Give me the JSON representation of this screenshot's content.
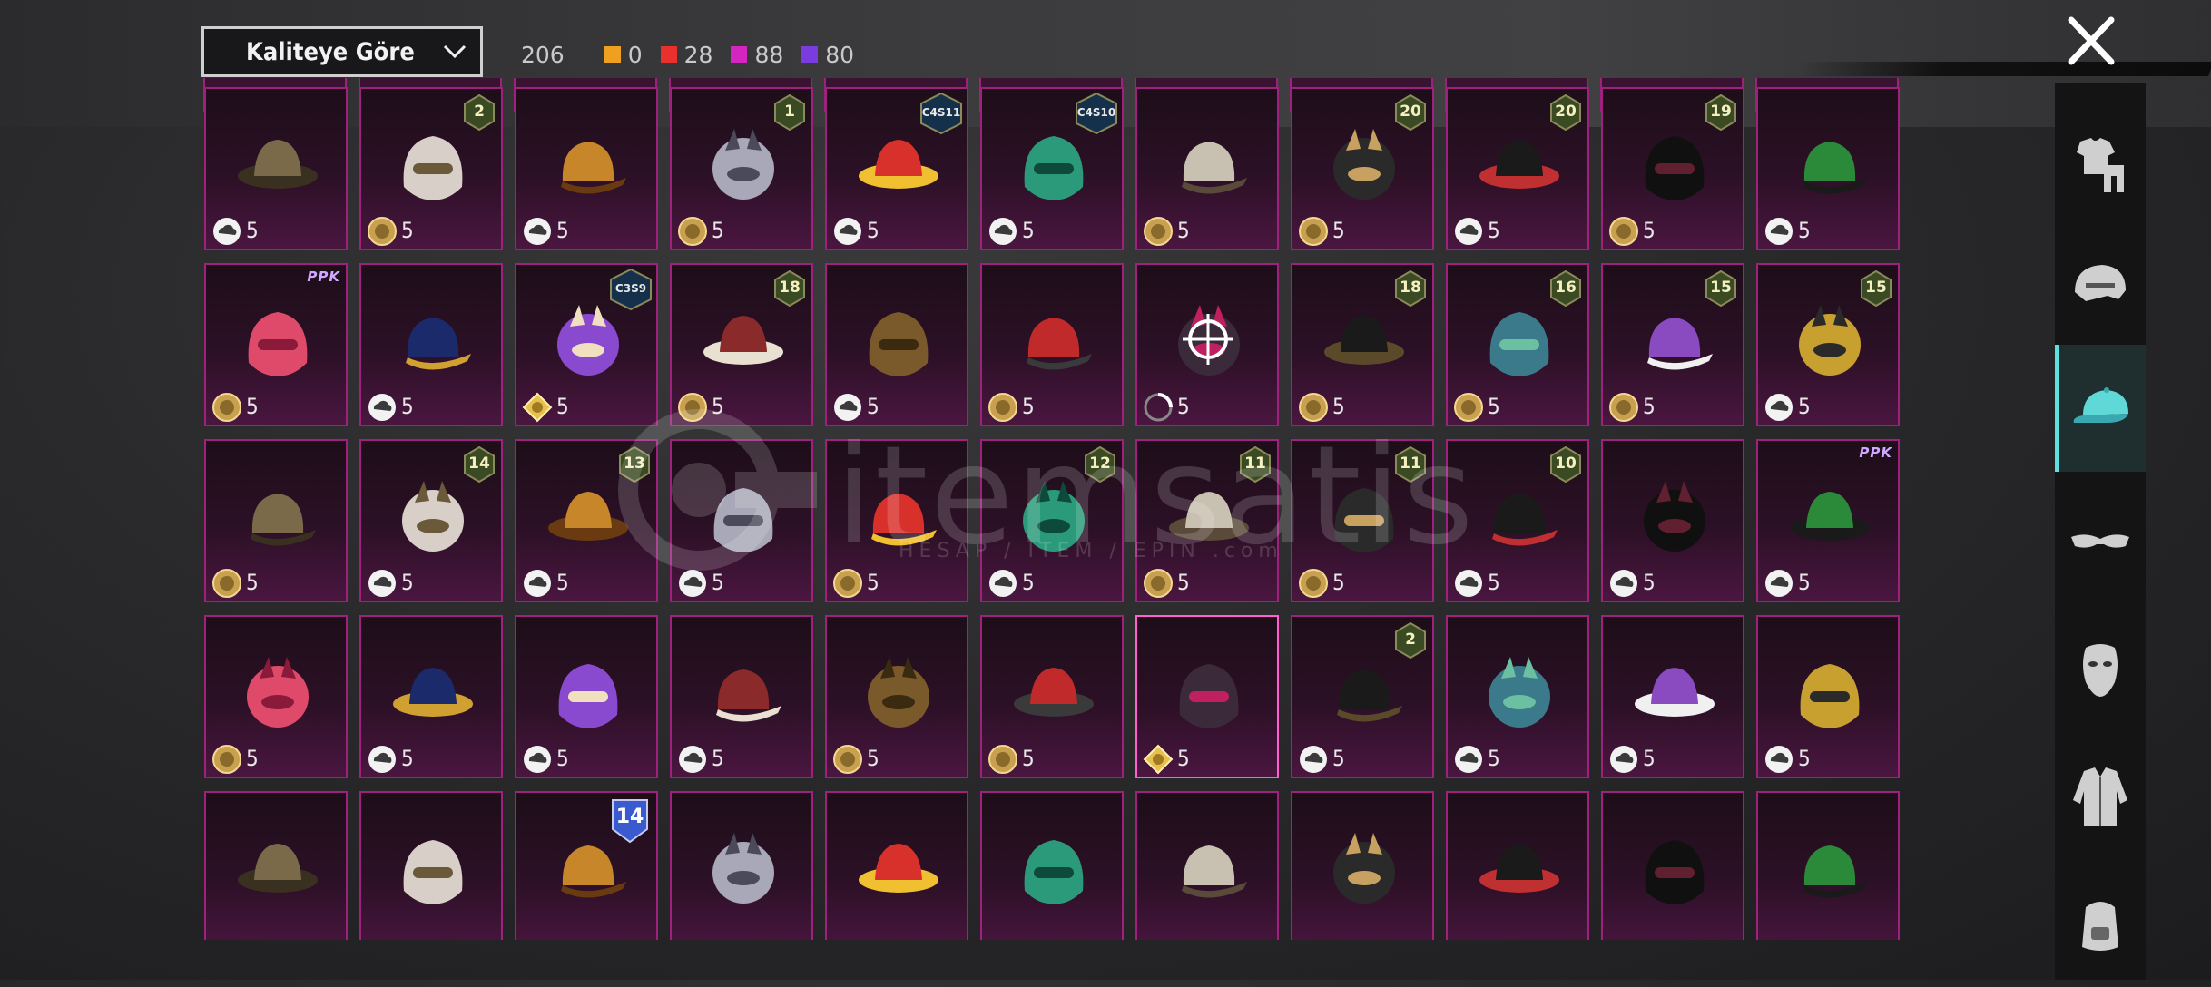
{
  "header": {
    "sort_label": "Kaliteye Göre",
    "total": "206",
    "counts": [
      {
        "value": "0",
        "color": "#f0a020"
      },
      {
        "value": "28",
        "color": "#e8302c"
      },
      {
        "value": "88",
        "color": "#d425c0"
      },
      {
        "value": "80",
        "color": "#7a3ce0"
      }
    ]
  },
  "watermark": {
    "brand": "itemsatis",
    "sub": "HESAP / ITEM / EPIN .com"
  },
  "categories": [
    {
      "name": "outfit-icon"
    },
    {
      "name": "helmet-icon"
    },
    {
      "name": "hat-icon",
      "active": true
    },
    {
      "name": "glasses-icon"
    },
    {
      "name": "mask-icon"
    },
    {
      "name": "jacket-icon"
    },
    {
      "name": "backpack-icon"
    }
  ],
  "rows": [
    [
      {
        "item": "straw-hat",
        "qty": "5",
        "coin": "cloud"
      },
      {
        "item": "white-bandana-hat",
        "qty": "5",
        "coin": "gold",
        "level": "2"
      },
      {
        "item": "potato-mask",
        "qty": "5",
        "coin": "cloud"
      },
      {
        "item": "grey-feather-headband",
        "qty": "5",
        "coin": "gold",
        "level": "1"
      },
      {
        "item": "red-cap",
        "qty": "5",
        "coin": "cloud",
        "code": "C4S11"
      },
      {
        "item": "green-horned-helmet",
        "qty": "5",
        "coin": "cloud",
        "code": "C4S10"
      },
      {
        "item": "plague-doctor-mask",
        "qty": "5",
        "coin": "gold"
      },
      {
        "item": "bunny-ear-hair",
        "qty": "5",
        "coin": "gold",
        "level": "20"
      },
      {
        "item": "panther-mask",
        "qty": "5",
        "coin": "cloud",
        "level": "20"
      },
      {
        "item": "black-bun-hair",
        "qty": "5",
        "coin": "gold",
        "level": "19"
      },
      {
        "item": "green-armored-helmet",
        "qty": "5",
        "coin": "cloud"
      }
    ],
    [
      {
        "item": "pink-bob-hair",
        "qty": "5",
        "coin": "gold",
        "ppk": "PPK"
      },
      {
        "item": "masked-warrior-helmet",
        "qty": "5",
        "coin": "cloud"
      },
      {
        "item": "purple-wizard-hat",
        "qty": "5",
        "coin": "diamond",
        "code": "C3S9"
      },
      {
        "item": "top-hat-skull",
        "qty": "5",
        "coin": "gold",
        "level": "18"
      },
      {
        "item": "woven-helmet",
        "qty": "5",
        "coin": "cloud"
      },
      {
        "item": "red-headphones",
        "qty": "5",
        "coin": "gold"
      },
      {
        "item": "dark-feather-hat",
        "qty": "5",
        "coin": "loading",
        "target": true
      },
      {
        "item": "black-messy-hair",
        "qty": "5",
        "coin": "gold",
        "level": "18"
      },
      {
        "item": "peacock-headdress",
        "qty": "5",
        "coin": "gold",
        "level": "16"
      },
      {
        "item": "eagle-mask",
        "qty": "5",
        "coin": "gold",
        "level": "15"
      },
      {
        "item": "gold-knight-helmet",
        "qty": "5",
        "coin": "cloud",
        "level": "15"
      }
    ],
    [
      {
        "item": "pink-visor-helmet",
        "qty": "5",
        "coin": "gold"
      },
      {
        "item": "black-hair-band",
        "qty": "5",
        "coin": "cloud",
        "level": "14"
      },
      {
        "item": "devil-horn-cap",
        "qty": "5",
        "coin": "cloud",
        "level": "13"
      },
      {
        "item": "yellow-bird-hat",
        "qty": "5",
        "coin": "cloud"
      },
      {
        "item": "green-bucket-hat",
        "qty": "5",
        "coin": "gold"
      },
      {
        "item": "toast-mask",
        "qty": "5",
        "coin": "cloud",
        "level": "12"
      },
      {
        "item": "blue-feather-cap",
        "qty": "5",
        "coin": "gold",
        "level": "11"
      },
      {
        "item": "gold-crown-frame",
        "qty": "5",
        "coin": "gold",
        "level": "11"
      },
      {
        "item": "pink-squid-hat",
        "qty": "5",
        "coin": "cloud",
        "level": "10"
      },
      {
        "item": "white-bunny-hood",
        "qty": "5",
        "coin": "cloud"
      },
      {
        "item": "cat-mask",
        "qty": "5",
        "coin": "cloud",
        "ppk": "PPK"
      }
    ],
    [
      {
        "item": "yellow-tiger-helmet",
        "qty": "5",
        "coin": "gold"
      },
      {
        "item": "blue-hood",
        "qty": "5",
        "coin": "cloud"
      },
      {
        "item": "bronze-dome-helmet",
        "qty": "5",
        "coin": "cloud"
      },
      {
        "item": "orange-tribal-headdress",
        "qty": "5",
        "coin": "cloud"
      },
      {
        "item": "snowman-head",
        "qty": "5",
        "coin": "gold"
      },
      {
        "item": "green-pixel-dino",
        "qty": "5",
        "coin": "gold"
      },
      {
        "item": "white-fluffy-hair",
        "qty": "5",
        "coin": "diamond",
        "selected": true
      },
      {
        "item": "black-dreadlocks",
        "qty": "5",
        "coin": "cloud",
        "level": "2"
      },
      {
        "item": "white-dreadlocks",
        "qty": "5",
        "coin": "cloud"
      },
      {
        "item": "cowboy-goblin",
        "qty": "5",
        "coin": "cloud"
      },
      {
        "item": "pink-sun-hat",
        "qty": "5",
        "coin": "cloud"
      }
    ],
    [
      {
        "item": "black-beret"
      },
      {
        "item": "wolf-mask"
      },
      {
        "item": "officer-cap",
        "medal": "14"
      },
      {
        "item": "rooster-mask"
      },
      {
        "item": "jester-hat"
      },
      {
        "item": "frog-cap"
      },
      {
        "item": "vr-headset"
      },
      {
        "item": "purple-baseball-cap"
      },
      {
        "item": "devil-horn-headset"
      },
      {
        "item": "red-visor-helmet"
      },
      {
        "item": "black-visor-helmet"
      }
    ]
  ]
}
